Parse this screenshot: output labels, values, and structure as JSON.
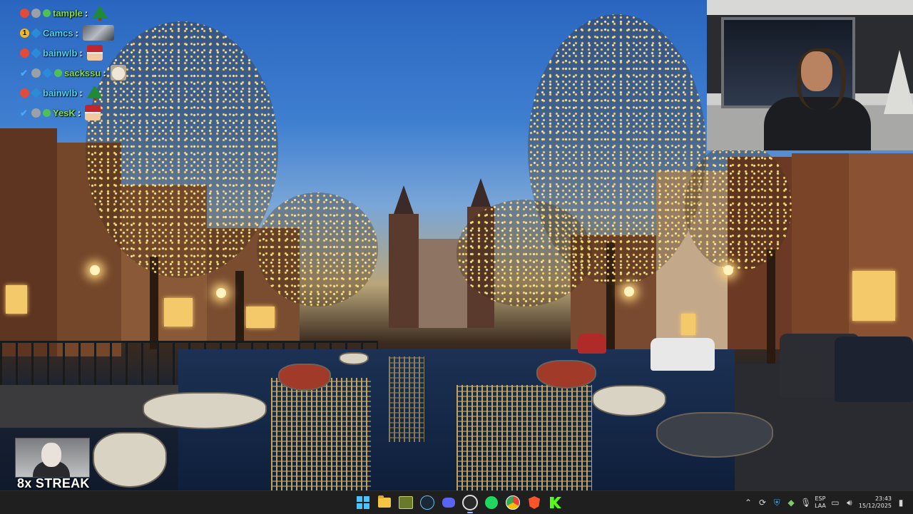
{
  "chat": {
    "messages": [
      {
        "username": "tample",
        "colon": ":",
        "badges": [
          "red-badge",
          "grey-badge",
          "green-badge"
        ],
        "emote": "tree-emote",
        "name_color": "#7fe05a"
      },
      {
        "username": "Camcs",
        "colon": ":",
        "badges": [
          "gold-badge",
          "blue-badge"
        ],
        "badge_gold_text": "1",
        "emote": "photo-emote",
        "name_color": "#4dd6ff"
      },
      {
        "username": "bainwlb",
        "colon": ":",
        "badges": [
          "red-badge",
          "blue-badge"
        ],
        "emote": "santa-hat-emote",
        "name_color": "#4dd6ff"
      },
      {
        "username": "sackssu",
        "colon": ":",
        "badges": [
          "check-badge",
          "grey-badge",
          "blue-badge",
          "green-badge"
        ],
        "emote": "cat-emote",
        "name_color": "#7fe05a"
      },
      {
        "username": "bainwlb",
        "colon": ":",
        "badges": [
          "red-badge",
          "blue-badge"
        ],
        "emote": "tree-emote",
        "name_color": "#4dd6ff"
      },
      {
        "username": "YesK",
        "colon": ":",
        "badges": [
          "check-badge",
          "grey-badge",
          "green-badge"
        ],
        "emote": "santa-hat-emote",
        "name_color": "#7fe05a"
      }
    ]
  },
  "streak": {
    "label": "8x STREAK"
  },
  "taskbar": {
    "apps": [
      {
        "name": "start-button",
        "icon": "windows-icon"
      },
      {
        "name": "file-explorer",
        "icon": "folder-icon"
      },
      {
        "name": "game-app",
        "icon": "game-icon"
      },
      {
        "name": "steam",
        "icon": "steam-icon"
      },
      {
        "name": "discord",
        "icon": "discord-icon"
      },
      {
        "name": "obs",
        "icon": "obs-icon"
      },
      {
        "name": "spotify",
        "icon": "spotify-icon"
      },
      {
        "name": "chrome",
        "icon": "chrome-icon"
      },
      {
        "name": "brave",
        "icon": "brave-icon"
      },
      {
        "name": "kick",
        "icon": "kick-icon"
      }
    ],
    "tray": {
      "lang_line1": "ESP",
      "lang_line2": "LAA",
      "time": "23:43",
      "date": "15/12/2025"
    }
  },
  "colors": {
    "taskbar_bg": "#1f1f1f",
    "chat_name_blue": "#4dd6ff",
    "chat_name_green": "#7fe05a",
    "windows_accent": "#4cc2ff"
  }
}
